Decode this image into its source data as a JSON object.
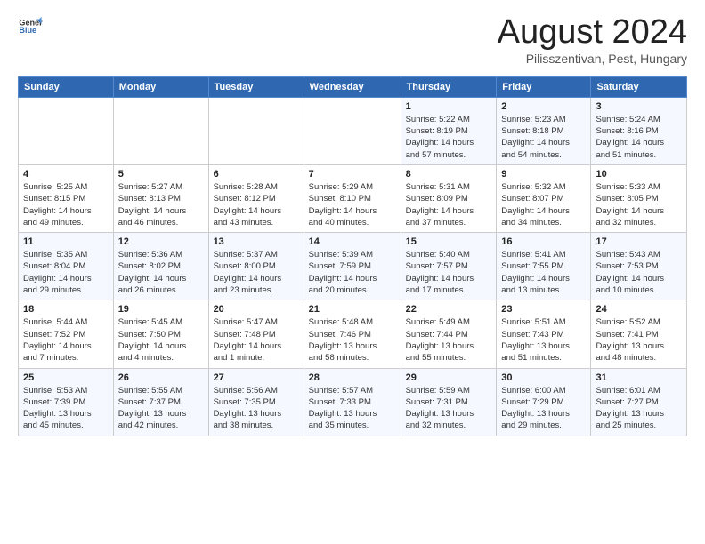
{
  "header": {
    "logo": {
      "general": "General",
      "blue": "Blue"
    },
    "title": "August 2024",
    "subtitle": "Pilisszentivan, Pest, Hungary"
  },
  "calendar": {
    "days_of_week": [
      "Sunday",
      "Monday",
      "Tuesday",
      "Wednesday",
      "Thursday",
      "Friday",
      "Saturday"
    ],
    "weeks": [
      [
        {
          "day": "",
          "info": ""
        },
        {
          "day": "",
          "info": ""
        },
        {
          "day": "",
          "info": ""
        },
        {
          "day": "",
          "info": ""
        },
        {
          "day": "1",
          "info": "Sunrise: 5:22 AM\nSunset: 8:19 PM\nDaylight: 14 hours\nand 57 minutes."
        },
        {
          "day": "2",
          "info": "Sunrise: 5:23 AM\nSunset: 8:18 PM\nDaylight: 14 hours\nand 54 minutes."
        },
        {
          "day": "3",
          "info": "Sunrise: 5:24 AM\nSunset: 8:16 PM\nDaylight: 14 hours\nand 51 minutes."
        }
      ],
      [
        {
          "day": "4",
          "info": "Sunrise: 5:25 AM\nSunset: 8:15 PM\nDaylight: 14 hours\nand 49 minutes."
        },
        {
          "day": "5",
          "info": "Sunrise: 5:27 AM\nSunset: 8:13 PM\nDaylight: 14 hours\nand 46 minutes."
        },
        {
          "day": "6",
          "info": "Sunrise: 5:28 AM\nSunset: 8:12 PM\nDaylight: 14 hours\nand 43 minutes."
        },
        {
          "day": "7",
          "info": "Sunrise: 5:29 AM\nSunset: 8:10 PM\nDaylight: 14 hours\nand 40 minutes."
        },
        {
          "day": "8",
          "info": "Sunrise: 5:31 AM\nSunset: 8:09 PM\nDaylight: 14 hours\nand 37 minutes."
        },
        {
          "day": "9",
          "info": "Sunrise: 5:32 AM\nSunset: 8:07 PM\nDaylight: 14 hours\nand 34 minutes."
        },
        {
          "day": "10",
          "info": "Sunrise: 5:33 AM\nSunset: 8:05 PM\nDaylight: 14 hours\nand 32 minutes."
        }
      ],
      [
        {
          "day": "11",
          "info": "Sunrise: 5:35 AM\nSunset: 8:04 PM\nDaylight: 14 hours\nand 29 minutes."
        },
        {
          "day": "12",
          "info": "Sunrise: 5:36 AM\nSunset: 8:02 PM\nDaylight: 14 hours\nand 26 minutes."
        },
        {
          "day": "13",
          "info": "Sunrise: 5:37 AM\nSunset: 8:00 PM\nDaylight: 14 hours\nand 23 minutes."
        },
        {
          "day": "14",
          "info": "Sunrise: 5:39 AM\nSunset: 7:59 PM\nDaylight: 14 hours\nand 20 minutes."
        },
        {
          "day": "15",
          "info": "Sunrise: 5:40 AM\nSunset: 7:57 PM\nDaylight: 14 hours\nand 17 minutes."
        },
        {
          "day": "16",
          "info": "Sunrise: 5:41 AM\nSunset: 7:55 PM\nDaylight: 14 hours\nand 13 minutes."
        },
        {
          "day": "17",
          "info": "Sunrise: 5:43 AM\nSunset: 7:53 PM\nDaylight: 14 hours\nand 10 minutes."
        }
      ],
      [
        {
          "day": "18",
          "info": "Sunrise: 5:44 AM\nSunset: 7:52 PM\nDaylight: 14 hours\nand 7 minutes."
        },
        {
          "day": "19",
          "info": "Sunrise: 5:45 AM\nSunset: 7:50 PM\nDaylight: 14 hours\nand 4 minutes."
        },
        {
          "day": "20",
          "info": "Sunrise: 5:47 AM\nSunset: 7:48 PM\nDaylight: 14 hours\nand 1 minute."
        },
        {
          "day": "21",
          "info": "Sunrise: 5:48 AM\nSunset: 7:46 PM\nDaylight: 13 hours\nand 58 minutes."
        },
        {
          "day": "22",
          "info": "Sunrise: 5:49 AM\nSunset: 7:44 PM\nDaylight: 13 hours\nand 55 minutes."
        },
        {
          "day": "23",
          "info": "Sunrise: 5:51 AM\nSunset: 7:43 PM\nDaylight: 13 hours\nand 51 minutes."
        },
        {
          "day": "24",
          "info": "Sunrise: 5:52 AM\nSunset: 7:41 PM\nDaylight: 13 hours\nand 48 minutes."
        }
      ],
      [
        {
          "day": "25",
          "info": "Sunrise: 5:53 AM\nSunset: 7:39 PM\nDaylight: 13 hours\nand 45 minutes."
        },
        {
          "day": "26",
          "info": "Sunrise: 5:55 AM\nSunset: 7:37 PM\nDaylight: 13 hours\nand 42 minutes."
        },
        {
          "day": "27",
          "info": "Sunrise: 5:56 AM\nSunset: 7:35 PM\nDaylight: 13 hours\nand 38 minutes."
        },
        {
          "day": "28",
          "info": "Sunrise: 5:57 AM\nSunset: 7:33 PM\nDaylight: 13 hours\nand 35 minutes."
        },
        {
          "day": "29",
          "info": "Sunrise: 5:59 AM\nSunset: 7:31 PM\nDaylight: 13 hours\nand 32 minutes."
        },
        {
          "day": "30",
          "info": "Sunrise: 6:00 AM\nSunset: 7:29 PM\nDaylight: 13 hours\nand 29 minutes."
        },
        {
          "day": "31",
          "info": "Sunrise: 6:01 AM\nSunset: 7:27 PM\nDaylight: 13 hours\nand 25 minutes."
        }
      ]
    ]
  }
}
